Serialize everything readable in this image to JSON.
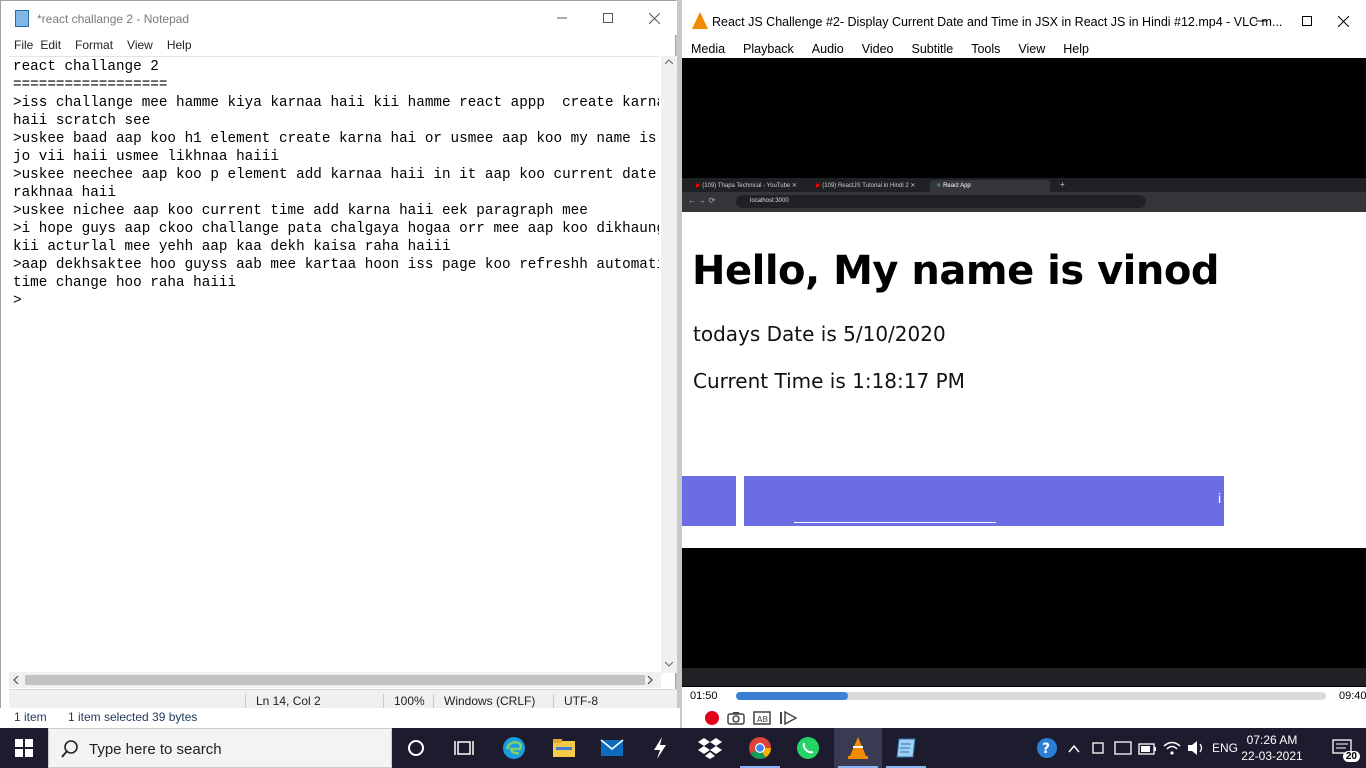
{
  "notepad": {
    "title": "*react challange 2 - Notepad",
    "menu": [
      "File",
      "Edit",
      "Format",
      "View",
      "Help"
    ],
    "content": "react challange 2\n==================\n>iss challange mee hamme kiya karnaa haii kii hamme react appp  create karna\nhaii scratch see\n>uskee baad aap koo h1 element create karna hai or usmee aap koo my name is\njo vii haii usmee likhnaa haiii\n>uskee neechee aap koo p element add karnaa haii in it aap koo current date\nrakhnaa haii\n>uskee nichee aap koo current time add karna haii eek paragraph mee\n>i hope guys aap ckoo challange pata chalgaya hogaa orr mee aap koo dikhaungaa\nkii acturlal mee yehh aap kaa dekh kaisa raha haiii\n>aap dekhsaktee hoo guyss aab mee kartaa hoon iss page koo refreshh automatically\ntime change hoo raha haiii\n>",
    "status": {
      "position": "Ln 14, Col 2",
      "zoom": "100%",
      "line_ending": "Windows (CRLF)",
      "encoding": "UTF-8"
    }
  },
  "explorer_status": {
    "items": "1 item",
    "selected": "1 item selected  39 bytes"
  },
  "vlc": {
    "title": "React JS Challenge #2- Display Current Date and Time in JSX in React JS in Hindi #12.mp4 - VLC m...",
    "menu": [
      "Media",
      "Playback",
      "Audio",
      "Video",
      "Subtitle",
      "Tools",
      "View",
      "Help"
    ],
    "time_elapsed": "01:50",
    "time_total": "09:40",
    "progress": 0.19
  },
  "browser": {
    "tabs": [
      "(109) Thapa Technical - YouTube",
      "(109) ReactJS Tutorial in Hindi 2",
      "React App"
    ],
    "url": "localhost:3000",
    "heading": "Hello, My name is vinod",
    "date_text": "todays Date is 5/10/2020",
    "time_text": "Current Time is 1:18:17 PM",
    "banner_char": "i"
  },
  "taskbar": {
    "search_placeholder": "Type here to search",
    "language": "ENG",
    "time": "07:26 AM",
    "date": "22-03-2021",
    "notification_count": "20"
  },
  "colors": {
    "taskbar": "#1c1c2e",
    "vlc_orange": "#f28a00",
    "banner": "#6c6ce3",
    "seek_fill": "#3a7fd5"
  }
}
